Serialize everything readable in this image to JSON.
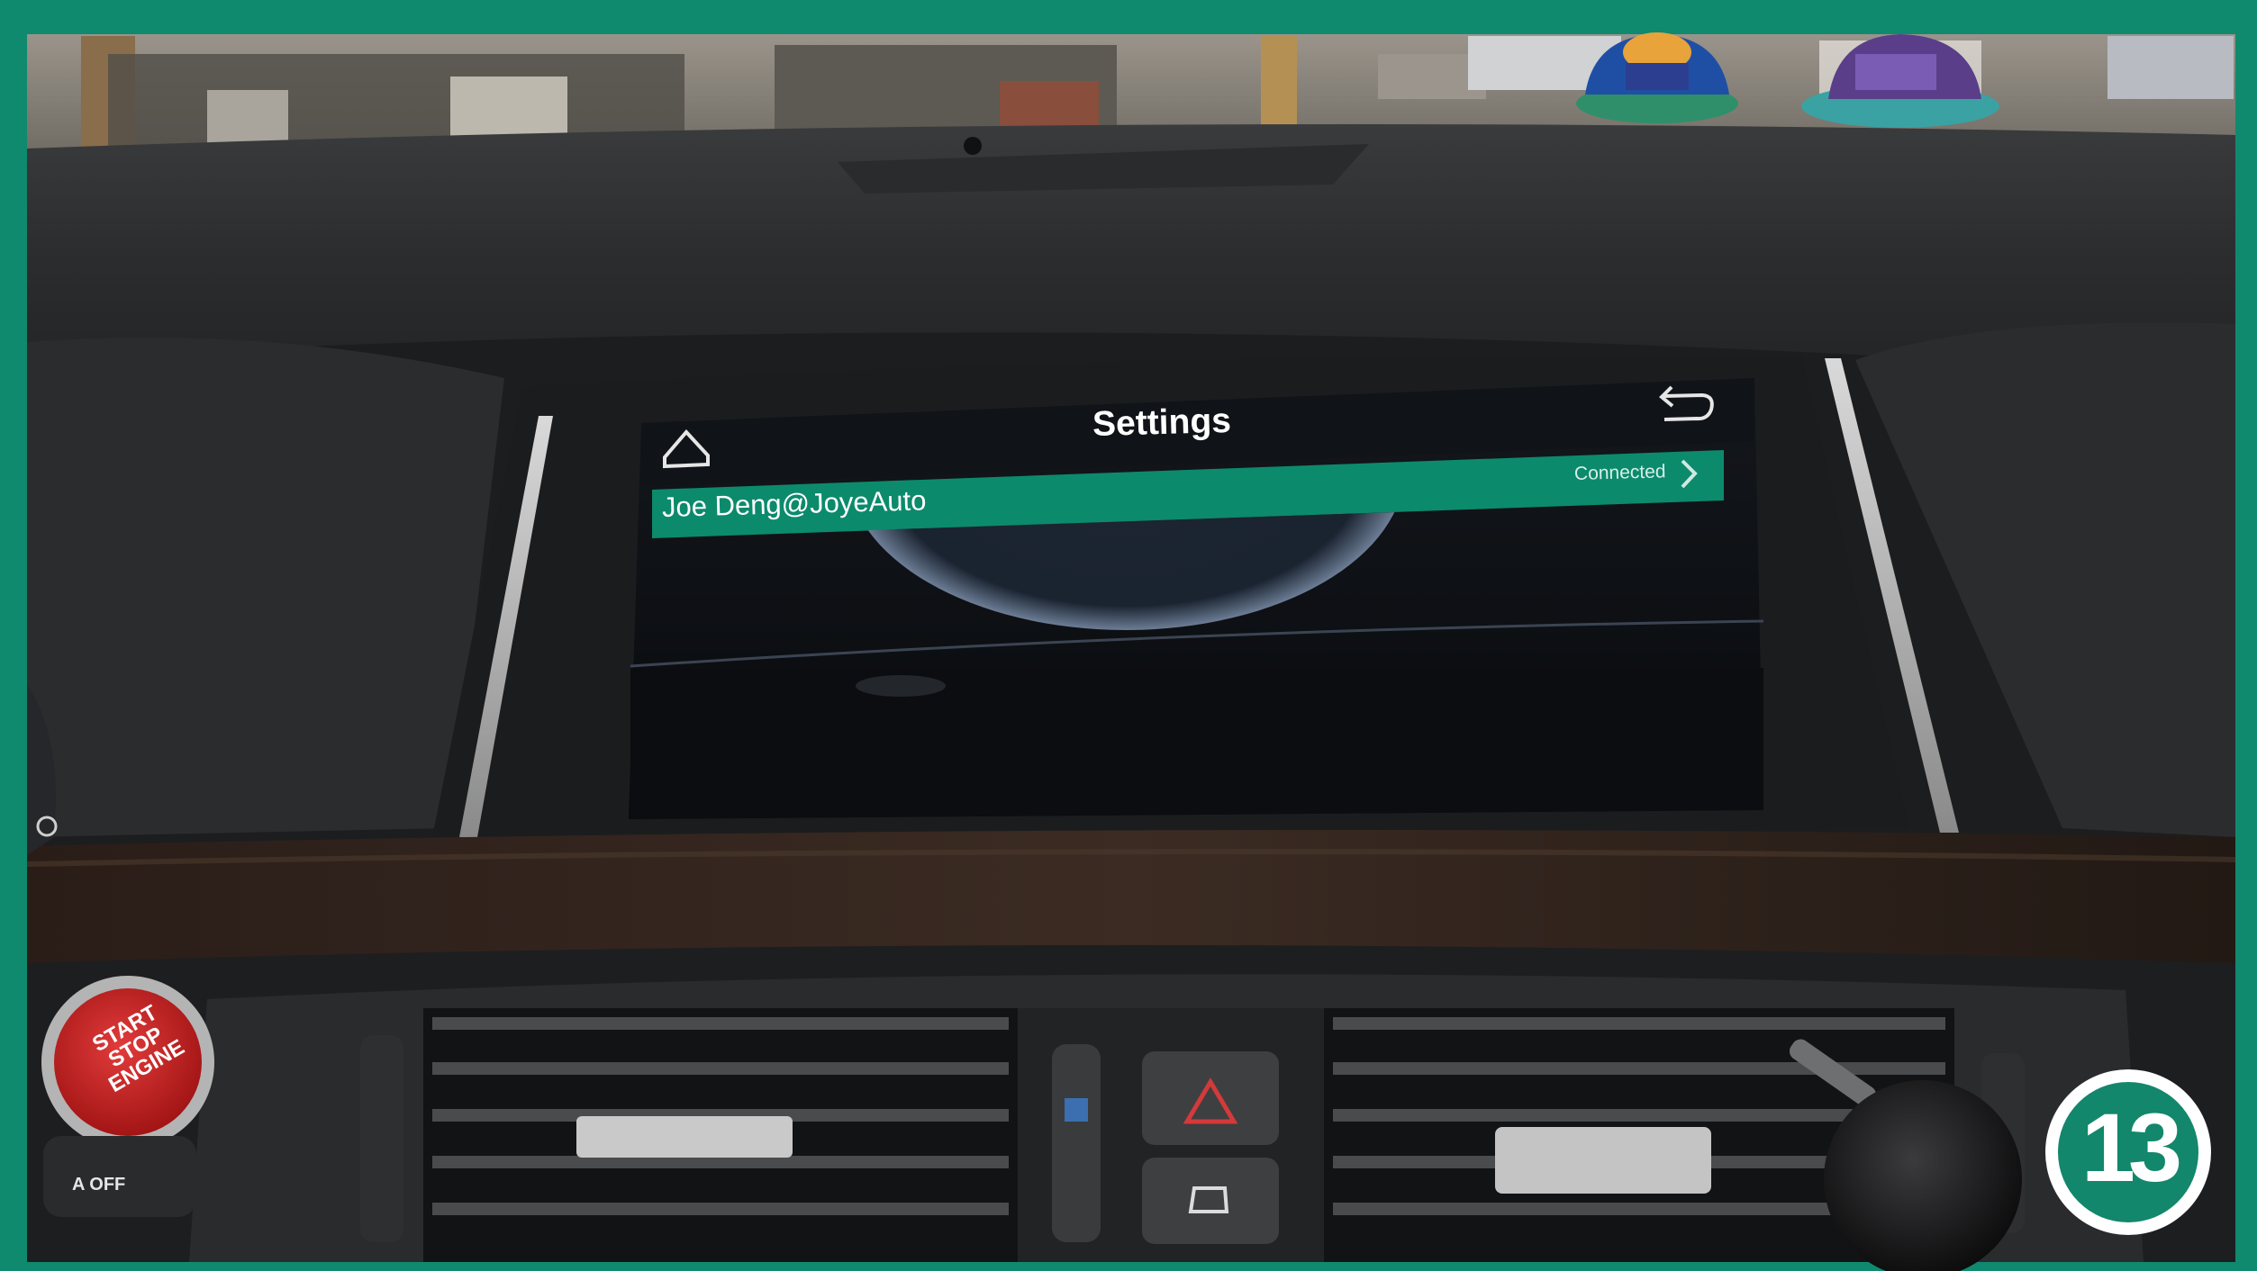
{
  "screen": {
    "title": "Settings",
    "device_name": "Joe Deng@JoyeAuto",
    "connection_status": "Connected",
    "accent_color": "#0c8a6c"
  },
  "badge": {
    "number": "13",
    "color": "#12876b"
  },
  "car_labels": {
    "start_stop": "START STOP ENGINE",
    "auto_off": "A OFF"
  },
  "frame_color": "#0f8a6e"
}
